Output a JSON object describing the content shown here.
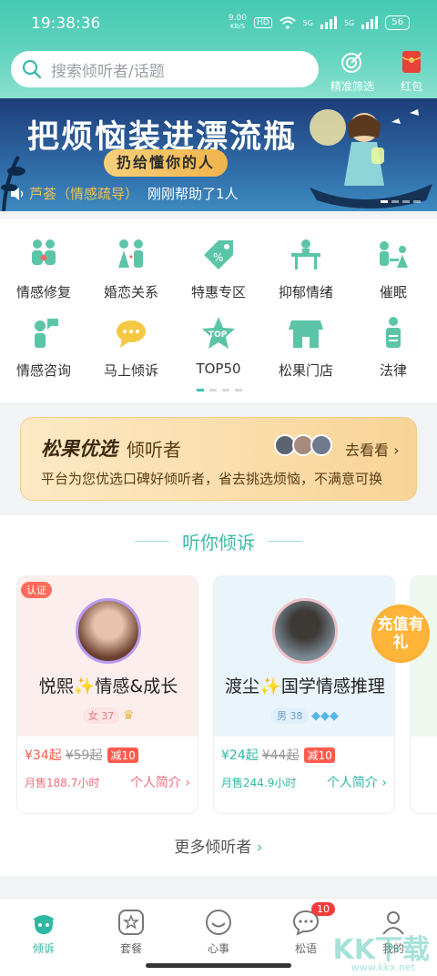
{
  "status_bar": {
    "time": "19:38:36",
    "net_speed_value": "9.00",
    "net_speed_unit": "KB/S",
    "hd_label": "HD",
    "signal_label_1": "5G",
    "signal_label_2": "5G",
    "battery": "56"
  },
  "header": {
    "search_placeholder": "搜索倾听者/话题",
    "filter_label": "精准筛选",
    "redpacket_label": "红包"
  },
  "banner": {
    "title": "把烦恼装进漂流瓶",
    "subtitle": "扔给懂你的人",
    "ticker_name": "芦荟（情感疏导）",
    "ticker_text": "刚刚帮助了1人"
  },
  "categories": [
    {
      "label": "情感修复",
      "icon": "couple-icon"
    },
    {
      "label": "婚恋关系",
      "icon": "marriage-icon"
    },
    {
      "label": "特惠专区",
      "icon": "discount-tag-icon"
    },
    {
      "label": "抑郁情绪",
      "icon": "desk-person-icon"
    },
    {
      "label": "催眠",
      "icon": "hypnosis-icon"
    },
    {
      "label": "情感咨询",
      "icon": "consult-icon"
    },
    {
      "label": "马上倾诉",
      "icon": "chat-bubble-icon"
    },
    {
      "label": "TOP50",
      "icon": "top-star-icon"
    },
    {
      "label": "松果门店",
      "icon": "store-icon"
    },
    {
      "label": "法律",
      "icon": "law-icon"
    }
  ],
  "promo": {
    "brand": "松果优选",
    "title": "倾听者",
    "action": "去看看",
    "description": "平台为您优选口碑好倾听者，省去挑选烦恼，不满意可换"
  },
  "listeners_section": {
    "title": "听你倾诉",
    "more": "更多倾听者",
    "recharge_badge": "充值有礼",
    "cards": [
      {
        "auth": "认证",
        "name": "悦熙✨情感&成长",
        "gender": "女 37",
        "price": "¥34起",
        "original_price": "¥59起",
        "reduce": "减10",
        "sales": "月售188.7小时",
        "intro": "个人简介"
      },
      {
        "name": "渡尘✨国学情感推理",
        "gender": "男 38",
        "price": "¥24起",
        "original_price": "¥44起",
        "reduce": "减10",
        "sales": "月售244.9小时",
        "intro": "个人简介"
      }
    ]
  },
  "tabbar": {
    "items": [
      {
        "label": "倾诉",
        "active": true
      },
      {
        "label": "套餐",
        "active": false
      },
      {
        "label": "心事",
        "active": false
      },
      {
        "label": "松语",
        "active": false,
        "badge": "10"
      },
      {
        "label": "我的",
        "active": false
      }
    ]
  },
  "watermark": {
    "text": "KK下载",
    "url": "www.kkx.net"
  },
  "colors": {
    "accent": "#3cbba8",
    "price": "#ff5a4e",
    "promo_bg": "#f8d497"
  }
}
